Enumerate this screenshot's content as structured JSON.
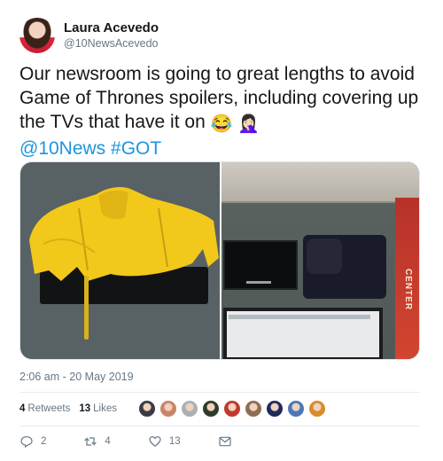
{
  "author": {
    "display_name": "Laura Acevedo",
    "handle": "@10NewsAcevedo"
  },
  "tweet": {
    "text": "Our newsroom is going to great lengths to avoid Game of Thrones spoilers, including covering up the TVs that have it on",
    "emoji_1": "😂",
    "emoji_2": "🤦🏻‍♀️",
    "mention": "@10News",
    "hashtag": "#GOT"
  },
  "photo_right": {
    "wall_sign_text": "CENTER"
  },
  "timestamp": "2:06 am - 20 May 2019",
  "stats": {
    "retweets_count": "4",
    "retweets_label": "Retweets",
    "likes_count": "13",
    "likes_label": "Likes"
  },
  "likers": [
    {
      "color": "#3b3b45"
    },
    {
      "color": "#c9846a"
    },
    {
      "color": "#aab0b6"
    },
    {
      "color": "#2e3a2a"
    },
    {
      "color": "#c0392b"
    },
    {
      "color": "#8d6e55"
    },
    {
      "color": "#1f2a5a"
    },
    {
      "color": "#4a78b8"
    },
    {
      "color": "#d98b2b"
    }
  ],
  "actions": {
    "reply_count": "2",
    "retweet_count": "4",
    "like_count": "13"
  },
  "colors": {
    "link": "#1b95e0",
    "secondary_text": "#657786",
    "coat_yellow": "#f2c81b"
  }
}
